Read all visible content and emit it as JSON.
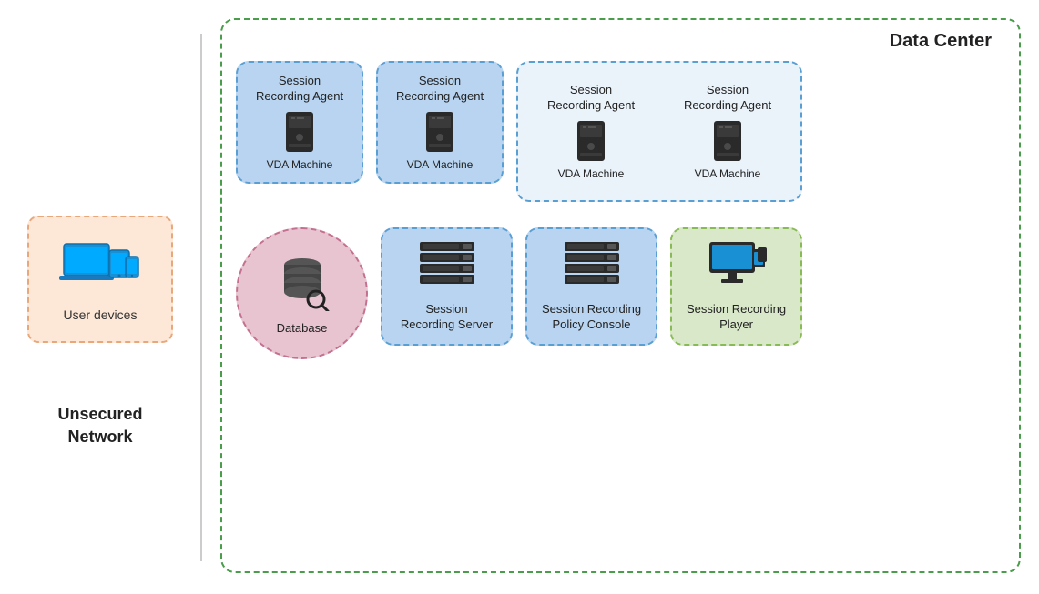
{
  "left": {
    "unsecured_network": "Unsecured\nNetwork",
    "user_devices_label": "User devices"
  },
  "right": {
    "data_center_title": "Data Center",
    "agents": [
      {
        "title": "Session\nRecording Agent",
        "sub": "VDA\nMachine"
      },
      {
        "title": "Session\nRecording Agent",
        "sub": "VDA\nMachine"
      },
      {
        "title": "Session\nRecording Agent",
        "sub": "VDA\nMachine"
      },
      {
        "title": "Session\nRecording Agent",
        "sub": "VDA\nMachine"
      }
    ],
    "database_label": "Database",
    "session_recording_server": "Session\nRecording Server",
    "session_recording_policy": "Session Recording\nPolicy Console",
    "session_recording_player": "Session Recording\nPlayer"
  }
}
